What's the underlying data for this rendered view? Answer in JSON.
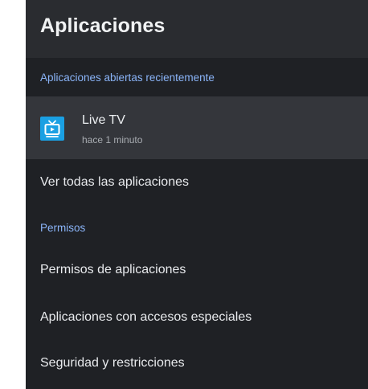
{
  "header": {
    "title": "Aplicaciones"
  },
  "recent": {
    "section_label": "Aplicaciones abiertas recientemente",
    "apps": [
      {
        "name": "Live TV",
        "time": "hace 1 minuto",
        "icon": "tv-icon",
        "icon_color": "#1aa0e3"
      }
    ]
  },
  "menu": {
    "see_all": "Ver todas las aplicaciones"
  },
  "permissions": {
    "section_label": "Permisos",
    "items": [
      {
        "label": "Permisos de aplicaciones"
      },
      {
        "label": "Aplicaciones con accesos especiales"
      },
      {
        "label": "Seguridad y restricciones"
      }
    ]
  },
  "colors": {
    "background": "#1f2125",
    "header_background": "#2a2c30",
    "selected_row": "#34363b",
    "section_accent": "#8ab4f8"
  }
}
